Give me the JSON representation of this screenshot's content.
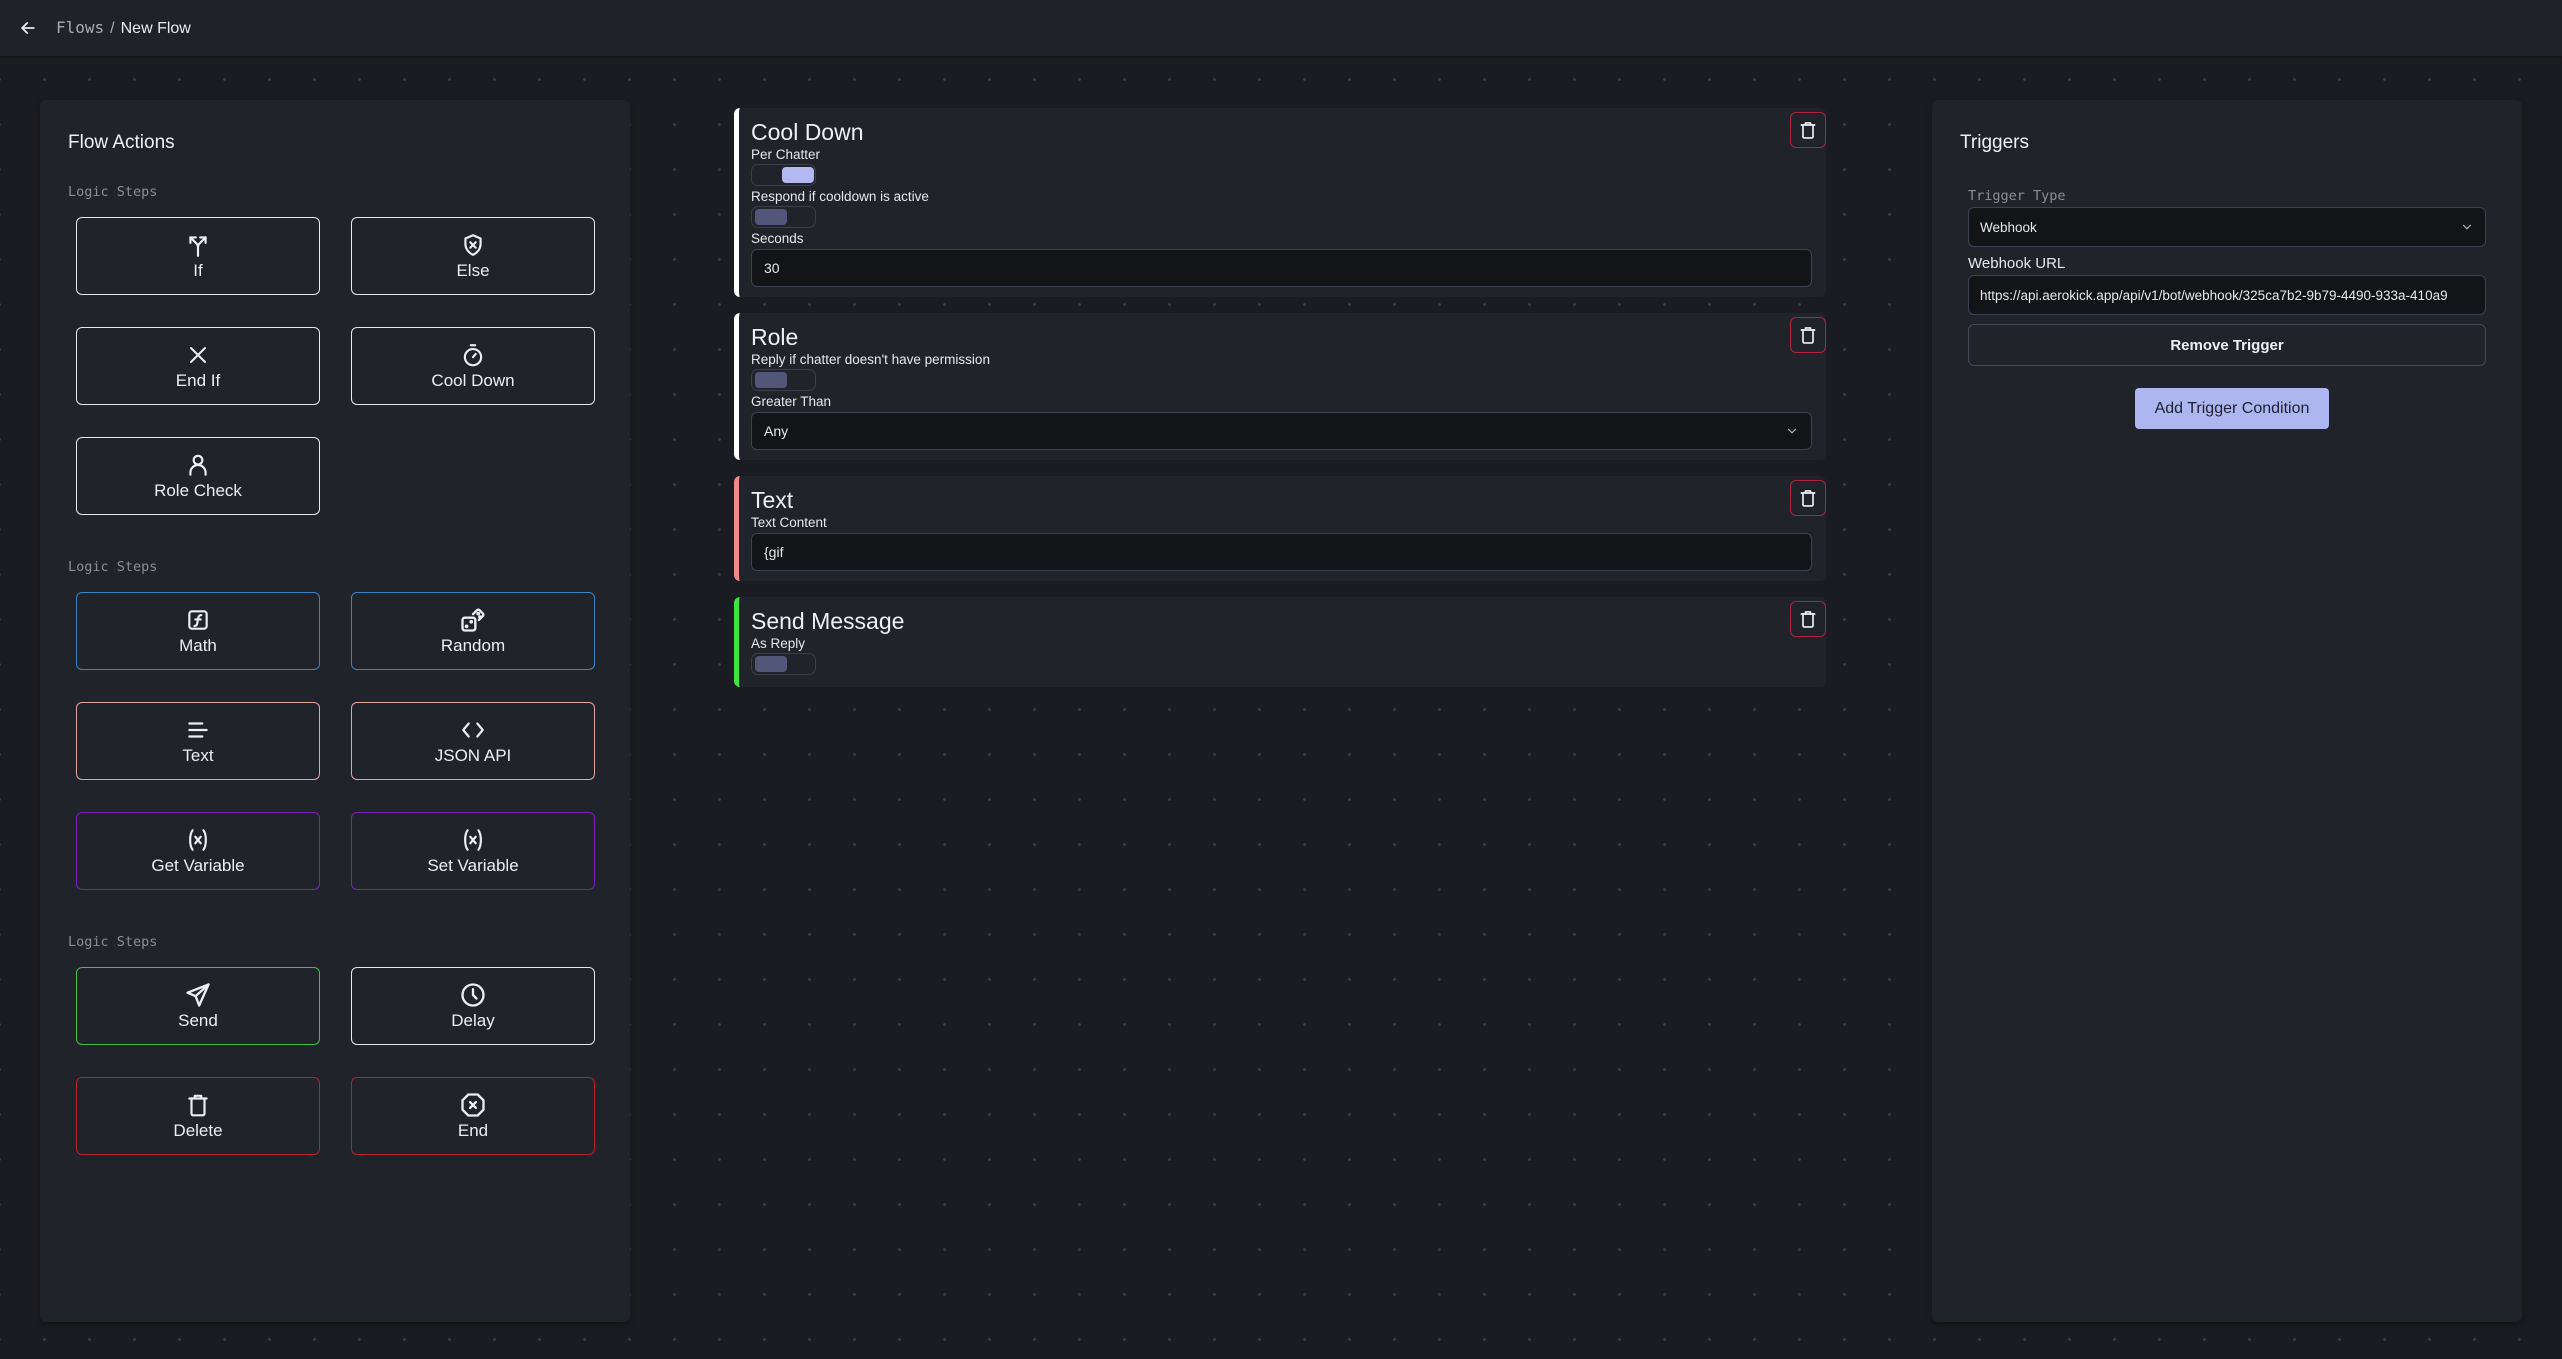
{
  "header": {
    "breadcrumb_root": "Flows",
    "breadcrumb_separator": "/",
    "breadcrumb_current": "New Flow",
    "back_icon": "arrow-left-icon"
  },
  "flow_actions": {
    "title": "Flow Actions",
    "sections": [
      {
        "label": "Logic Steps",
        "items": [
          {
            "label": "If",
            "icon": "split-arrows-icon",
            "color": "#e6e7eb"
          },
          {
            "label": "Else",
            "icon": "shield-x-icon",
            "color": "#e6e7eb"
          },
          {
            "label": "End If",
            "icon": "x-icon",
            "color": "#e6e7eb"
          },
          {
            "label": "Cool Down",
            "icon": "stopwatch-icon",
            "color": "#e6e7eb"
          },
          {
            "label": "Role Check",
            "icon": "user-icon",
            "color": "#e6e7eb"
          }
        ]
      },
      {
        "label": "Logic Steps",
        "items": [
          {
            "label": "Math",
            "icon": "function-icon",
            "color": "#3b82c8"
          },
          {
            "label": "Random",
            "icon": "dice-icon",
            "color": "#3b82c8"
          },
          {
            "label": "Text",
            "icon": "text-lines-icon",
            "color": "#e3a59e"
          },
          {
            "label": "JSON API",
            "icon": "code-brackets-icon",
            "color": "#e3a59e"
          },
          {
            "label": "Get Variable",
            "icon": "variable-icon",
            "color": "#7b22b8"
          },
          {
            "label": "Set Variable",
            "icon": "variable-icon",
            "color": "#7b22b8"
          }
        ]
      },
      {
        "label": "Logic Steps",
        "items": [
          {
            "label": "Send",
            "icon": "send-icon",
            "color": "#43c043"
          },
          {
            "label": "Delay",
            "icon": "clock-icon",
            "color": "#e6e7eb"
          },
          {
            "label": "Delete",
            "icon": "trash-icon",
            "color": "#b3232d"
          },
          {
            "label": "End",
            "icon": "octagon-x-icon",
            "color": "#b3232d"
          }
        ]
      }
    ]
  },
  "flow_steps": [
    {
      "title": "Cool Down",
      "accent": "#ffffff",
      "toggle1_label": "Per Chatter",
      "toggle1_on": true,
      "toggle2_label": "Respond if cooldown is active",
      "toggle2_on": false,
      "input_label": "Seconds",
      "input_value": "30"
    },
    {
      "title": "Role",
      "accent": "#ffffff",
      "toggle1_label": "Reply if chatter doesn't have permission",
      "toggle1_on": false,
      "select_label": "Greater Than",
      "select_value": "Any"
    },
    {
      "title": "Text",
      "accent": "#f08a8a",
      "input_label": "Text Content",
      "input_value": "{gif"
    },
    {
      "title": "Send Message",
      "accent": "#3ee43e",
      "toggle1_label": "As Reply",
      "toggle1_on": false
    }
  ],
  "triggers": {
    "title": "Triggers",
    "trigger_type_label": "Trigger Type",
    "trigger_type_value": "Webhook",
    "webhook_url_label": "Webhook URL",
    "webhook_url_value": "https://api.aerokick.app/api/v1/bot/webhook/325ca7b2-9b79-4490-933a-410a9",
    "remove_label": "Remove Trigger",
    "add_condition_label": "Add Trigger Condition"
  },
  "colors": {
    "accent": "#aeb6f0",
    "danger": "#b0223f",
    "background": "#1b1c21",
    "panel": "#21232b"
  }
}
